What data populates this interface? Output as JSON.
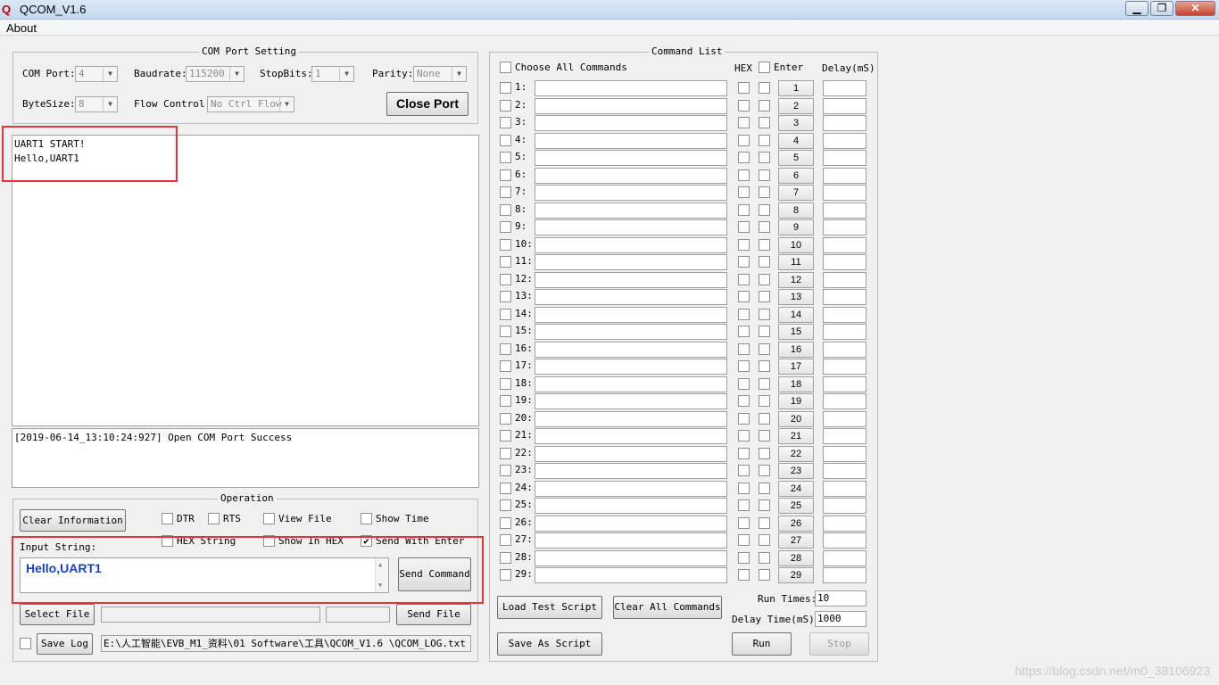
{
  "window": {
    "title": "QCOM_V1.6",
    "logo": "Q",
    "minimize": "▁",
    "maximize": "❐",
    "close": "✕"
  },
  "menu": {
    "about": "About"
  },
  "com_setting": {
    "title": "COM Port Setting",
    "com_port_label": "COM Port:",
    "com_port_value": "4",
    "baudrate_label": "Baudrate:",
    "baudrate_value": "115200",
    "stopbits_label": "StopBits:",
    "stopbits_value": "1",
    "parity_label": "Parity:",
    "parity_value": "None",
    "bytesize_label": "ByteSize:",
    "bytesize_value": "8",
    "flow_label": "Flow Control:",
    "flow_value": "No Ctrl Flow",
    "close_port": "Close Port"
  },
  "receive": {
    "line1": "UART1 START!",
    "line2": "Hello,UART1"
  },
  "log": {
    "line1": "[2019-06-14_13:10:24:927] Open COM Port Success"
  },
  "operation": {
    "title": "Operation",
    "clear_info": "Clear Information",
    "dtr": "DTR",
    "rts": "RTS",
    "view_file": "View File",
    "show_time": "Show Time",
    "hex_string": "HEX String",
    "show_in_hex": "Show In HEX",
    "send_with_enter": "Send With Enter",
    "send_with_enter_checked": true,
    "input_label": "Input String:",
    "input_value": "Hello,UART1",
    "send_command": "Send Command",
    "select_file": "Select File",
    "send_file": "Send File",
    "save_log": "Save Log",
    "log_path": "E:\\人工智能\\EVB_M1_资料\\01 Software\\工具\\QCOM_V1.6 \\QCOM_LOG.txt"
  },
  "command_list": {
    "title": "Command List",
    "choose_all": "Choose All Commands",
    "hex_header": "HEX",
    "enter_header": "Enter",
    "delay_header": "Delay(mS)",
    "rows": [
      "1:",
      "2:",
      "3:",
      "4:",
      "5:",
      "6:",
      "7:",
      "8:",
      "9:",
      "10:",
      "11:",
      "12:",
      "13:",
      "14:",
      "15:",
      "16:",
      "17:",
      "18:",
      "19:",
      "20:",
      "21:",
      "22:",
      "23:",
      "24:",
      "25:",
      "26:",
      "27:",
      "28:",
      "29:"
    ],
    "buttons": [
      "1",
      "2",
      "3",
      "4",
      "5",
      "6",
      "7",
      "8",
      "9",
      "10",
      "11",
      "12",
      "13",
      "14",
      "15",
      "16",
      "17",
      "18",
      "19",
      "20",
      "21",
      "22",
      "23",
      "24",
      "25",
      "26",
      "27",
      "28",
      "29"
    ],
    "load_script": "Load Test Script",
    "clear_all": "Clear All Commands",
    "save_script": "Save As Script",
    "run_times_label": "Run Times:",
    "run_times_value": "10",
    "delay_time_label": "Delay Time(mS):",
    "delay_time_value": "1000",
    "run": "Run",
    "stop": "Stop"
  },
  "watermark": "https://blog.csdn.net/m0_38106923"
}
